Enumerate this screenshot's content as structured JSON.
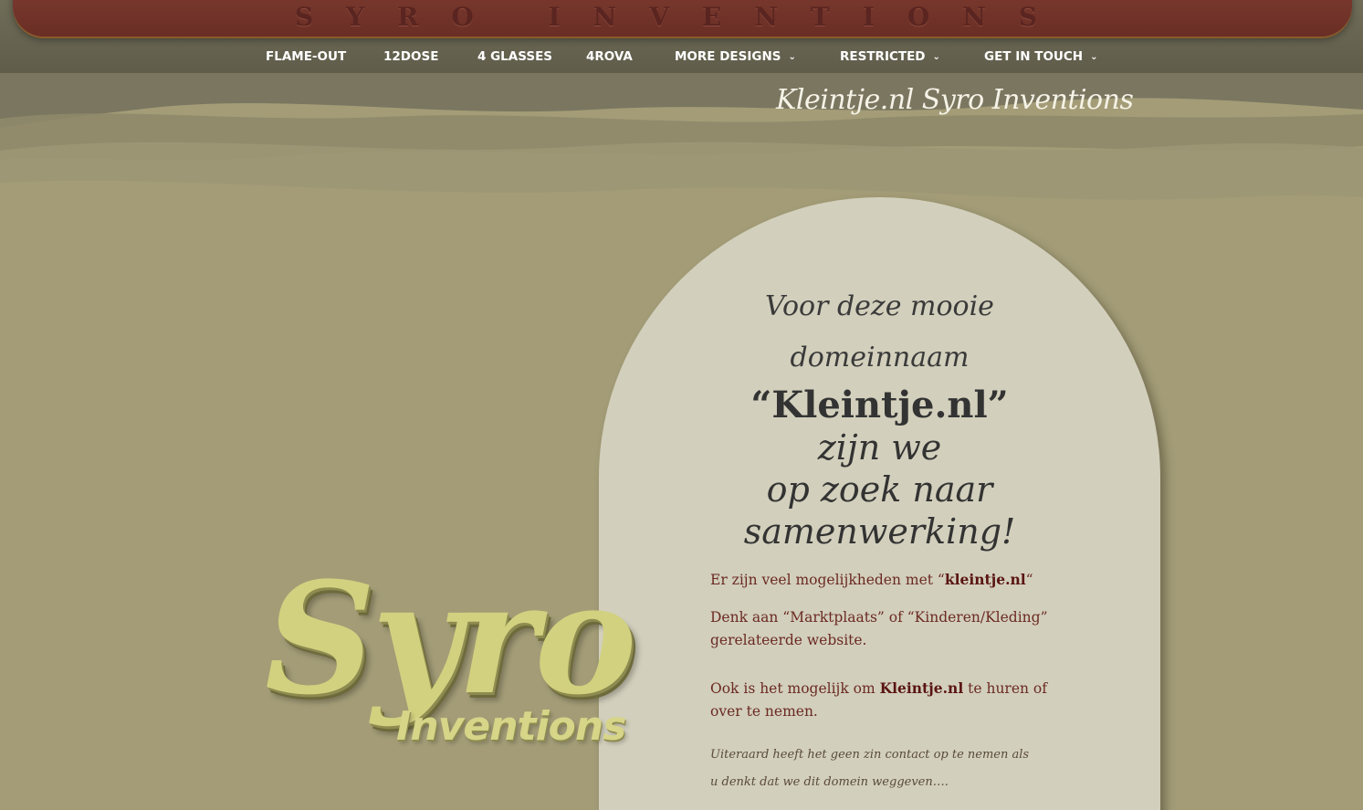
{
  "header": {
    "brand_title": "SYRO INVENTIONS",
    "tagline": "Kleintje.nl Syro Inventions"
  },
  "nav": {
    "items": [
      {
        "label": "FLAME-OUT"
      },
      {
        "label": "12DOSE"
      },
      {
        "label": "4 GLASSES"
      },
      {
        "label": "4ROVA"
      },
      {
        "label": "MORE DESIGNS"
      },
      {
        "label": "RESTRICTED"
      },
      {
        "label": "GET IN TOUCH"
      }
    ]
  },
  "card": {
    "intro_line1": "Voor deze mooie",
    "intro_line2": "domeinnaam",
    "domain_quote": "“Kleintje.nl”",
    "phrase_line1": "zijn we",
    "phrase_line2": "op zoek naar",
    "phrase_line3": "samenwerking!",
    "para1_before": "Er zijn veel mogelijkheden met “",
    "para1_bold": "kleintje.nl",
    "para1_after": "“",
    "para2": "Denk aan “Marktplaats” of “Kinderen/Kleding” gerelateerde website.",
    "para3_before": "Ook is het mogelijk om ",
    "para3_bold": "Kleintje.nl",
    "para3_after": " te huren of over te nemen.",
    "para4": "Uiteraard heeft het geen zin contact op te nemen als u denkt dat we dit domein weggeven…."
  },
  "logo": {
    "word1": "Syro",
    "word2": "Inventions"
  },
  "colors": {
    "background": "#a39c77",
    "brand_bar": "#7d3b30",
    "card": "#d2cfbc",
    "text_accent": "#6b2a22"
  }
}
